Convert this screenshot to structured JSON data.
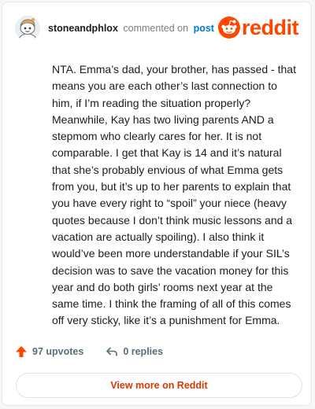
{
  "header": {
    "username": "stoneandphlox",
    "commented_text": "commented on",
    "post_link": "post",
    "logo_text": "reddit"
  },
  "comment": {
    "body": "NTA. Emma’s dad, your brother, has passed - that means you are each other’s last connection to him, if I’m reading the situation properly? Meanwhile, Kay has two living parents AND a stepmom who clearly cares for her. It is not comparable. I get that Kay is 14 and it’s natural that she’s probably envious of what Emma gets from you, but it’s up to her parents to explain that you have every right to “spoil” your niece (heavy quotes because I don’t think music lessons and a vacation are actually spoiling). I also think it would’ve been more understandable if your SIL’s decision was to save the vacation money for this year and do both girls’ rooms next year at the same time. I think the framing of all of this comes off very sticky, like it’s a punishment for Emma."
  },
  "footer": {
    "upvotes": "97 upvotes",
    "replies": "0 replies",
    "view_more": "View more on Reddit"
  },
  "colors": {
    "brand": "#ff4500",
    "link": "#0079d3",
    "muted": "#576f76"
  },
  "icons": {
    "avatar": "snoo-avatar",
    "logo": "reddit-snoo-icon",
    "upvote": "upvote-arrow-icon",
    "reply": "reply-arrow-icon"
  }
}
